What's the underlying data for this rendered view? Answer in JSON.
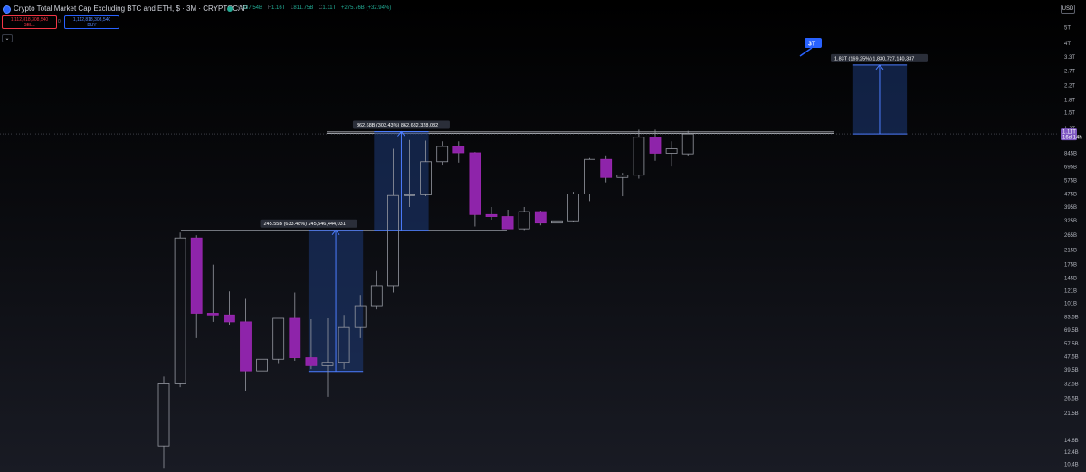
{
  "header": {
    "symbol_title": "Crypto Total Market Cap Excluding BTC and ETH, $ · 3M · CRYPTOCAP",
    "ohlc": {
      "o_label": "O",
      "o_value": "837.54B",
      "h_label": "H",
      "h_value": "1.16T",
      "l_label": "L",
      "l_value": "811.75B",
      "c_label": "C",
      "c_value": "1.11T",
      "change": "+275.76B (+32.94%)"
    },
    "sell_price": "1,112,818,308,540",
    "sell_label": "SELL",
    "spread": "0",
    "buy_price": "1,112,818,308,540",
    "buy_label": "BUY",
    "collapse_glyph": "⌄",
    "currency": "USD"
  },
  "colors": {
    "up_body": "transparent",
    "up_border": "#9598a1",
    "down_body": "#8e24aa",
    "down_border": "#9c27b0",
    "measure_fill": "#1e3a78",
    "measure_line": "#4c7dff",
    "callout": "#2962ff"
  },
  "chart_data": {
    "type": "candlestick",
    "y_scale": "log",
    "y_ticks": [
      "5T",
      "4T",
      "3.3T",
      "2.7T",
      "2.2T",
      "1.8T",
      "1.5T",
      "1.2T",
      "845B",
      "695B",
      "575B",
      "475B",
      "395B",
      "325B",
      "265B",
      "215B",
      "175B",
      "145B",
      "121B",
      "101B",
      "83.5B",
      "69.5B",
      "57.5B",
      "47.5B",
      "39.5B",
      "32.5B",
      "26.5B",
      "21.5B",
      "14.6B",
      "12.4B",
      "10.4B"
    ],
    "candles": [
      {
        "o": 13.5,
        "h": 36,
        "l": 9.8,
        "c": 32.5
      },
      {
        "o": 32.5,
        "h": 275,
        "l": 31,
        "c": 255
      },
      {
        "o": 255,
        "h": 265,
        "l": 62,
        "c": 88
      },
      {
        "o": 88,
        "h": 175,
        "l": 78,
        "c": 86
      },
      {
        "o": 86,
        "h": 120,
        "l": 75,
        "c": 78
      },
      {
        "o": 78,
        "h": 108,
        "l": 29.5,
        "c": 39
      },
      {
        "o": 39,
        "h": 58,
        "l": 33,
        "c": 46
      },
      {
        "o": 46,
        "h": 82,
        "l": 43,
        "c": 82
      },
      {
        "o": 82,
        "h": 118,
        "l": 45,
        "c": 47
      },
      {
        "o": 47,
        "h": 81,
        "l": 40,
        "c": 42
      },
      {
        "o": 42,
        "h": 82,
        "l": 27,
        "c": 44
      },
      {
        "o": 44,
        "h": 86,
        "l": 40,
        "c": 72
      },
      {
        "o": 72,
        "h": 114,
        "l": 62,
        "c": 98
      },
      {
        "o": 98,
        "h": 160,
        "l": 93,
        "c": 130
      },
      {
        "o": 130,
        "h": 900,
        "l": 118,
        "c": 465
      },
      {
        "o": 465,
        "h": 1020,
        "l": 395,
        "c": 470
      },
      {
        "o": 470,
        "h": 1010,
        "l": 460,
        "c": 750
      },
      {
        "o": 750,
        "h": 1000,
        "l": 710,
        "c": 930
      },
      {
        "o": 930,
        "h": 1000,
        "l": 740,
        "c": 850
      },
      {
        "o": 850,
        "h": 860,
        "l": 300,
        "c": 355
      },
      {
        "o": 355,
        "h": 395,
        "l": 330,
        "c": 345
      },
      {
        "o": 345,
        "h": 380,
        "l": 300,
        "c": 290
      },
      {
        "o": 290,
        "h": 395,
        "l": 285,
        "c": 370
      },
      {
        "o": 370,
        "h": 375,
        "l": 305,
        "c": 315
      },
      {
        "o": 315,
        "h": 350,
        "l": 300,
        "c": 325
      },
      {
        "o": 325,
        "h": 490,
        "l": 320,
        "c": 475
      },
      {
        "o": 475,
        "h": 790,
        "l": 430,
        "c": 775
      },
      {
        "o": 775,
        "h": 820,
        "l": 560,
        "c": 600
      },
      {
        "o": 600,
        "h": 640,
        "l": 460,
        "c": 620
      },
      {
        "o": 620,
        "h": 1180,
        "l": 590,
        "c": 1060
      },
      {
        "o": 1060,
        "h": 1180,
        "l": 760,
        "c": 845
      },
      {
        "o": 845,
        "h": 1000,
        "l": 700,
        "c": 900
      },
      {
        "o": 837.54,
        "h": 1160,
        "l": 811.75,
        "c": 1110
      }
    ],
    "measures": [
      {
        "label": "245.55B (633.48%) 245,546,444,031",
        "from": 38.7,
        "to": 284.3
      },
      {
        "label": "862.68B (303.43%) 862,682,328,082",
        "from": 284.3,
        "to": 1147
      },
      {
        "label": "1.83T (169.25%) 1,830,727,140,337",
        "from": 1110,
        "to": 2940
      }
    ],
    "levels": [
      284.3,
      1130
    ],
    "callout": "3T",
    "last_price": "1.11T",
    "last_price_countdown": "16d 14h"
  }
}
